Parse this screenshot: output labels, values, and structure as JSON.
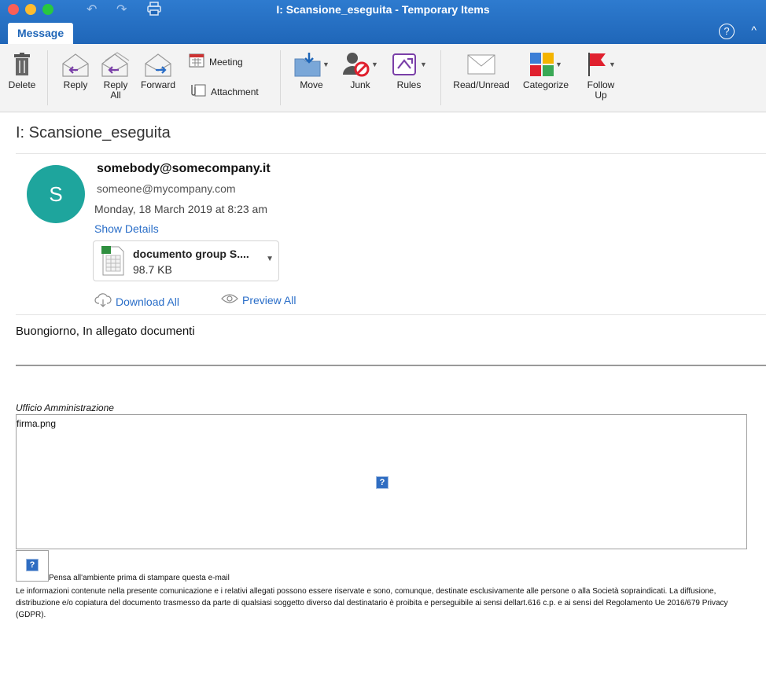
{
  "window": {
    "title": "I: Scansione_eseguita - Temporary Items",
    "tab": "Message",
    "help": "?",
    "collapse": "^"
  },
  "ribbon": {
    "delete": "Delete",
    "reply": "Reply",
    "reply_all_line1": "Reply",
    "reply_all_line2": "All",
    "forward": "Forward",
    "meeting": "Meeting",
    "attachment": "Attachment",
    "move": "Move",
    "junk": "Junk",
    "rules": "Rules",
    "read_unread": "Read/Unread",
    "categorize": "Categorize",
    "follow_up_line1": "Follow",
    "follow_up_line2": "Up"
  },
  "message": {
    "subject": "I: Scansione_eseguita",
    "avatar_letter": "S",
    "sender": "somebody@somecompany.it",
    "recipient": "someone@mycompany.com",
    "date": "Monday, 18 March 2019 at 8:23 am",
    "show_details": "Show Details",
    "attachment": {
      "name": "documento group S....",
      "size": "98.7 KB"
    },
    "download_all": "Download All",
    "preview_all": "Preview All",
    "body": "Buongiorno, In allegato documenti",
    "signature_office": "Ufficio Amministrazione",
    "image_name": "firma.png",
    "placeholder_glyph": "?",
    "env_note": "Pensa all'ambiente prima di stampare questa e-mail",
    "legal": "Le informazioni contenute nella presente comunicazione e i relativi allegati possono essere riservate e sono, comunque, destinate esclusivamente alle persone o alla Società sopraindicati. La diffusione, distribuzione e/o copiatura del documento trasmesso da parte di qualsiasi soggetto diverso dal destinatario è proibita e perseguibile ai sensi dellart.616 c.p. e ai sensi del Regolamento Ue 2016/679 Privacy (GDPR)."
  },
  "colors": {
    "titlebar": "#1f66b8",
    "link": "#2a6ec8",
    "avatar": "#1ea59d",
    "flag": "#e0202e"
  }
}
